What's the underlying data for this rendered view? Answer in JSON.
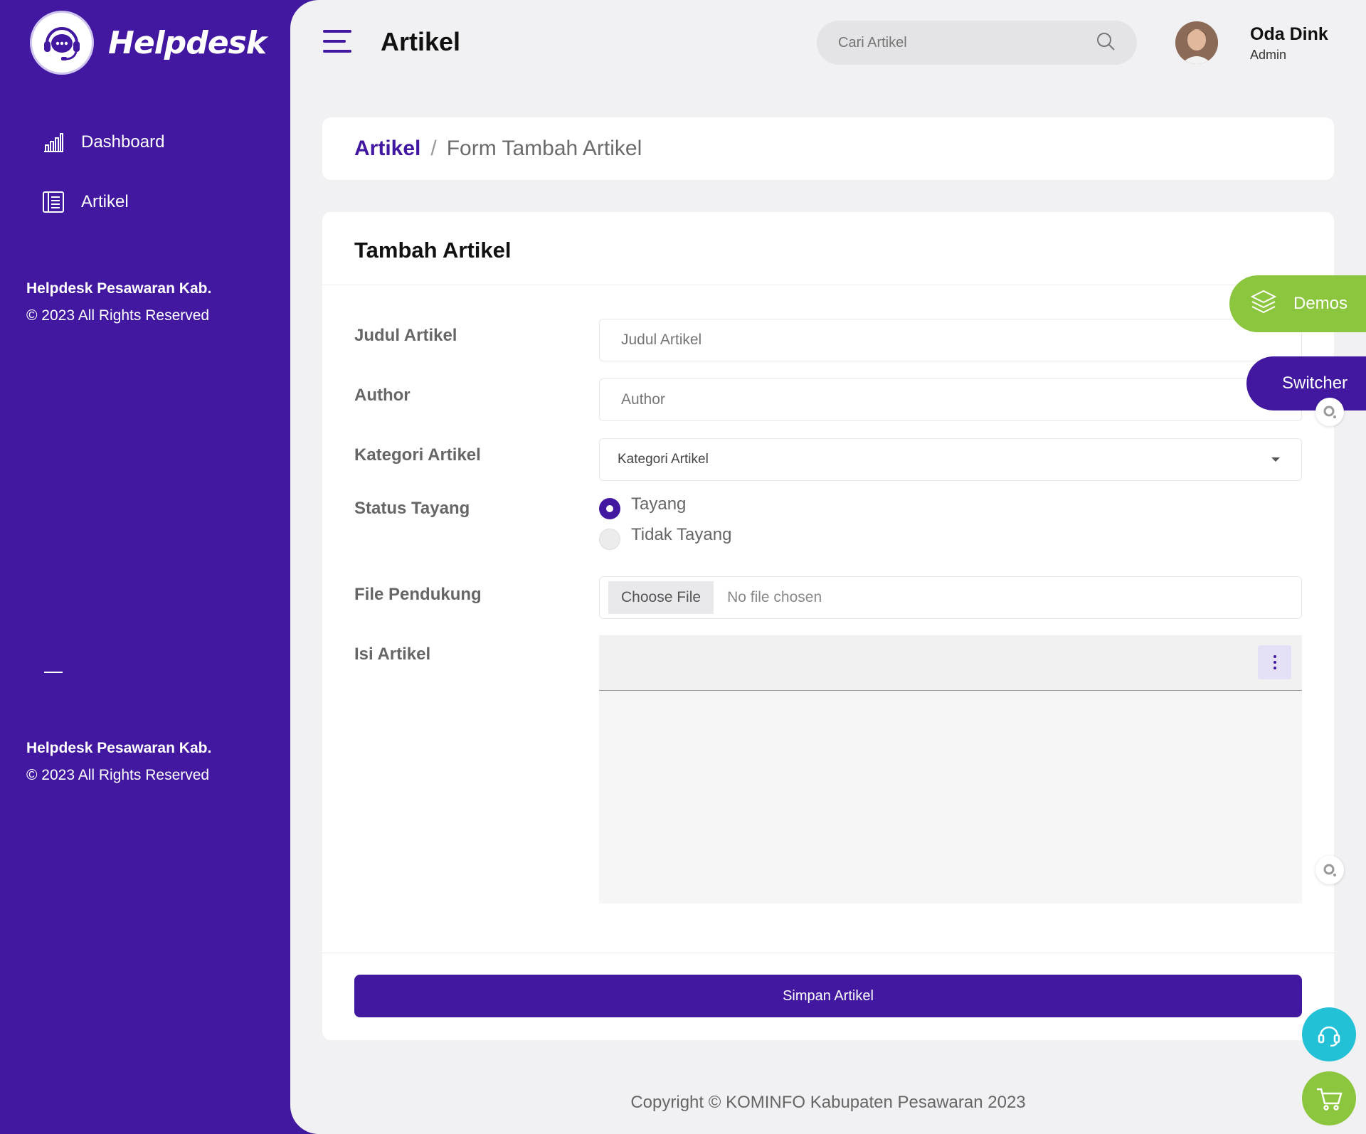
{
  "brand": {
    "name": "Helpdesk"
  },
  "sidebar": {
    "items": [
      {
        "label": "Dashboard",
        "icon": "bar-chart-icon"
      },
      {
        "label": "Artikel",
        "icon": "article-icon"
      }
    ],
    "footer": {
      "org": "Helpdesk Pesawaran Kab.",
      "rights": "© 2023 All Rights Reserved"
    }
  },
  "header": {
    "title": "Artikel",
    "search_placeholder": "Cari Artikel",
    "user_name": "Oda Dink",
    "user_role": "Admin"
  },
  "breadcrumb": {
    "parent": "Artikel",
    "separator": "/",
    "current": "Form Tambah Artikel"
  },
  "form": {
    "title": "Tambah Artikel",
    "judul_label": "Judul Artikel",
    "judul_placeholder": "Judul Artikel",
    "author_label": "Author",
    "author_placeholder": "Author",
    "kategori_label": "Kategori Artikel",
    "kategori_value": "Kategori Artikel",
    "status_label": "Status Tayang",
    "status_options": [
      "Tayang",
      "Tidak Tayang"
    ],
    "status_selected": "Tayang",
    "file_label": "File Pendukung",
    "file_button": "Choose File",
    "file_status": "No file chosen",
    "isi_label": "Isi Artikel",
    "submit_label": "Simpan Artikel"
  },
  "footer": {
    "copyright": "Copyright © KOMINFO Kabupaten Pesawaran 2023"
  },
  "widgets": {
    "demos_label": "Demos",
    "switcher_label": "Switcher"
  },
  "colors": {
    "primary": "#41189f",
    "demos": "#8cc63f",
    "support": "#22c1d6",
    "cart": "#8cc63f",
    "background": "#f1f1f3"
  }
}
